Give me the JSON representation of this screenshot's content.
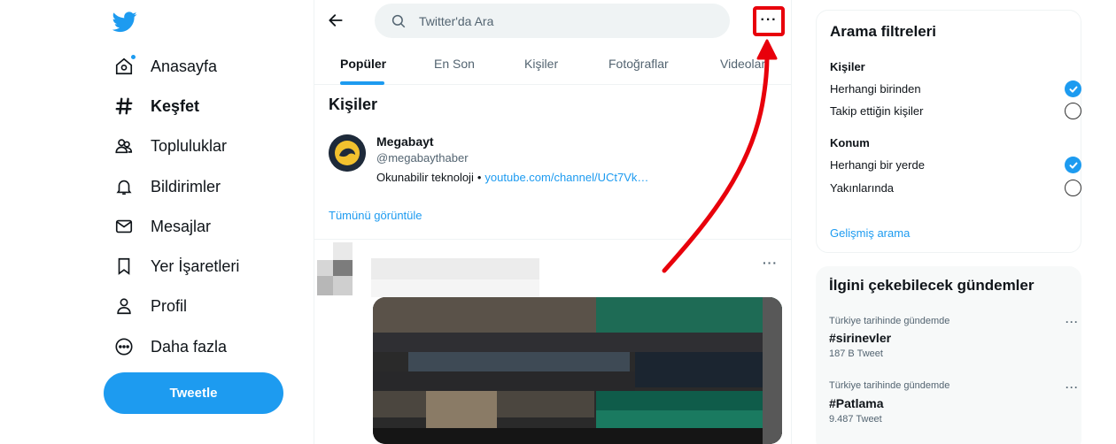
{
  "sidebar": {
    "logo_icon": "twitter-bird-icon",
    "items": [
      {
        "label": "Anasayfa",
        "icon": "home-icon",
        "active": false
      },
      {
        "label": "Keşfet",
        "icon": "hashtag-icon",
        "active": true
      },
      {
        "label": "Topluluklar",
        "icon": "communities-icon",
        "active": false
      },
      {
        "label": "Bildirimler",
        "icon": "bell-icon",
        "active": false
      },
      {
        "label": "Mesajlar",
        "icon": "envelope-icon",
        "active": false
      },
      {
        "label": "Yer İşaretleri",
        "icon": "bookmark-icon",
        "active": false
      },
      {
        "label": "Profil",
        "icon": "person-icon",
        "active": false
      },
      {
        "label": "Daha fazla",
        "icon": "more-circle-icon",
        "active": false
      }
    ],
    "tweet_button": "Tweetle"
  },
  "header": {
    "search_placeholder": "Twitter'da Ara",
    "more_label": "···"
  },
  "tabs": [
    "Popüler",
    "En Son",
    "Kişiler",
    "Fotoğraflar",
    "Videolar"
  ],
  "people": {
    "title": "Kişiler",
    "user": {
      "name": "Megabayt",
      "handle": "@megabaythaber",
      "bio": "Okunabilir teknoloji",
      "separator": "•",
      "link": "youtube.com/channel/UCt7Vk…"
    },
    "show_all": "Tümünü görüntüle"
  },
  "tweet": {
    "more_label": "···"
  },
  "filters": {
    "title": "Arama filtreleri",
    "groups": [
      {
        "title": "Kişiler",
        "options": [
          {
            "label": "Herhangi birinden",
            "selected": true
          },
          {
            "label": "Takip ettiğin kişiler",
            "selected": false
          }
        ]
      },
      {
        "title": "Konum",
        "options": [
          {
            "label": "Herhangi bir yerde",
            "selected": true
          },
          {
            "label": "Yakınlarında",
            "selected": false
          }
        ]
      }
    ],
    "advanced_link": "Gelişmiş arama"
  },
  "trends": {
    "title": "İlgini çekebilecek gündemler",
    "items": [
      {
        "context": "Türkiye tarihinde gündemde",
        "name": "#sirinevler",
        "count": "187 B Tweet"
      },
      {
        "context": "Türkiye tarihinde gündemde",
        "name": "#Patlama",
        "count": "9.487 Tweet"
      }
    ],
    "more_label": "···"
  },
  "colors": {
    "accent": "#1d9bf0",
    "annotation": "#e8000b",
    "text": "#0f1419",
    "secondary": "#536471"
  }
}
